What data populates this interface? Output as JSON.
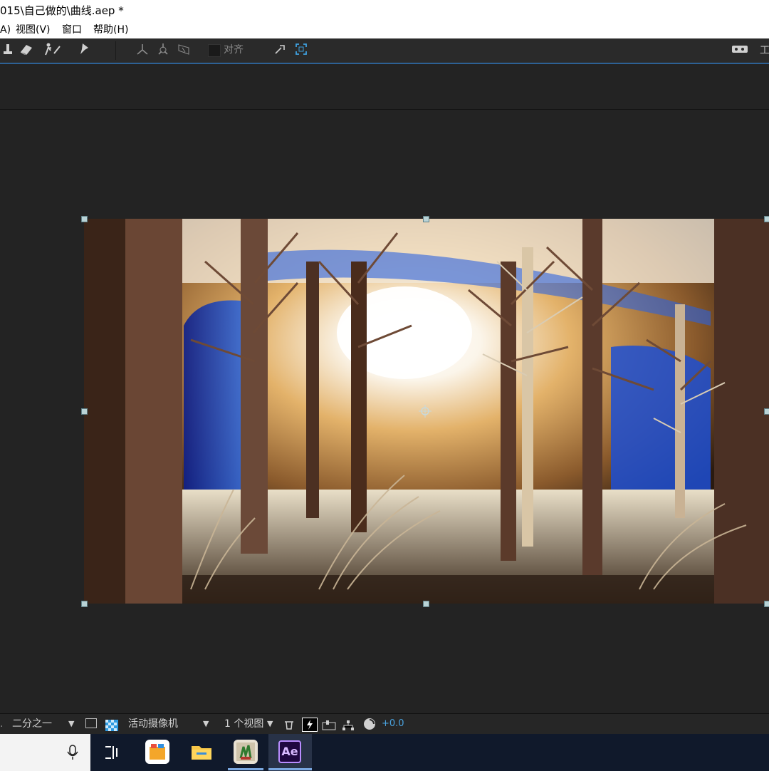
{
  "window": {
    "title": "015\\自己做的\\曲线.aep *"
  },
  "menu": {
    "items": [
      "A)",
      "视图(V)",
      "窗口",
      "帮助(H)"
    ]
  },
  "toolbar": {
    "tools": [
      "puppet-pin-icon",
      "eraser-icon",
      "roto-brush-icon",
      "pin-icon",
      "axis-local-icon",
      "axis-world-icon",
      "axis-view-icon"
    ],
    "align_label": "对齐",
    "right_label": "工"
  },
  "viewer": {
    "composition": "forest-scene",
    "colors": {
      "sky": "#f6f0e4",
      "blue": "#1e4bd6",
      "gold": "#d7a257",
      "trunk": "#5e3a2a"
    }
  },
  "bottom": {
    "resolution": "二分之一",
    "camera": "活动摄像机",
    "views": "1 个视图",
    "exposure": "+0.0",
    "accent": "#4aa3df"
  },
  "taskbar": {
    "apps": [
      "mic-icon",
      "task-view-icon",
      "store-icon",
      "file-explorer-icon",
      "plant-app-icon",
      "after-effects-icon"
    ],
    "ae_label": "Ae"
  }
}
